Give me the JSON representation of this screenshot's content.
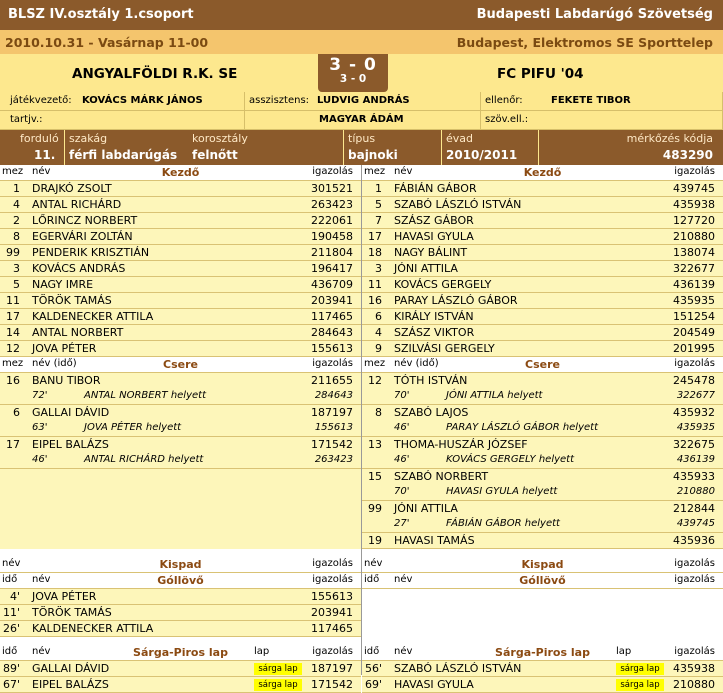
{
  "header": {
    "league": "BLSZ IV.osztály 1.csoport",
    "federation": "Budapesti Labdarúgó Szövetség",
    "date": "2010.10.31 - Vasárnap 11-00",
    "venue": "Budapest, Elektromos SE Sporttelep"
  },
  "match": {
    "home": "ANGYALFÖLDI R.K. SE",
    "away": "FC PIFU '04",
    "score": "3 - 0",
    "halftime": "3 - 0"
  },
  "officials": {
    "ref_label": "játékvezető:",
    "ref": "KOVÁCS MÁRK JÁNOS",
    "assist_label": "asszisztens:",
    "assist1": "LUDVIG ANDRÁS",
    "assist2": "MAGYAR ÁDÁM",
    "inspector_label": "ellenőr:",
    "inspector": "FEKETE TIBOR",
    "reserve_label": "tartjv.:",
    "reserve": "",
    "szov_label": "szöv.ell.:",
    "szov": ""
  },
  "info": {
    "round_label": "forduló",
    "round": "11.",
    "branch_label": "szakág",
    "branch": "férfi labdarúgás",
    "age_label": "korosztály",
    "age": "felnőtt",
    "type_label": "típus",
    "type": "bajnoki",
    "season_label": "évad",
    "season": "2010/2011",
    "code_label": "mérkőzés kódja",
    "code": "483290"
  },
  "labels": {
    "mez": "mez",
    "nev": "név",
    "igazolas": "igazolás",
    "ido": "idő",
    "nev_ido": "név (idő)",
    "lap": "lap",
    "kezdo": "Kezdő",
    "csere": "Csere",
    "kispad": "Kispad",
    "gollovo": "Góllövő",
    "sarga": "Sárga-Piros lap"
  },
  "home_start": [
    {
      "n": "1",
      "name": "DRAJKÓ ZSOLT",
      "id": "301521"
    },
    {
      "n": "4",
      "name": "ANTAL RICHÁRD",
      "id": "263423"
    },
    {
      "n": "2",
      "name": "LŐRINCZ NORBERT",
      "id": "222061"
    },
    {
      "n": "8",
      "name": "EGERVÁRI ZOLTÁN",
      "id": "190458"
    },
    {
      "n": "99",
      "name": "PENDERIK KRISZTIÁN",
      "id": "211804"
    },
    {
      "n": "3",
      "name": "KOVÁCS ANDRÁS",
      "id": "196417"
    },
    {
      "n": "5",
      "name": "NAGY IMRE",
      "id": "436709"
    },
    {
      "n": "11",
      "name": "TÖRÖK TAMÁS",
      "id": "203941"
    },
    {
      "n": "17",
      "name": "KALDENECKER ATTILA",
      "id": "117465"
    },
    {
      "n": "14",
      "name": "ANTAL NORBERT",
      "id": "284643"
    },
    {
      "n": "12",
      "name": "JOVA PÉTER",
      "id": "155613"
    }
  ],
  "away_start": [
    {
      "n": "1",
      "name": "FÁBIÁN GÁBOR",
      "id": "439745"
    },
    {
      "n": "5",
      "name": "SZABÓ LÁSZLÓ ISTVÁN",
      "id": "435938"
    },
    {
      "n": "7",
      "name": "SZÁSZ GÁBOR",
      "id": "127720"
    },
    {
      "n": "17",
      "name": "HAVASI GYULA",
      "id": "210880"
    },
    {
      "n": "18",
      "name": "NAGY BÁLINT",
      "id": "138074"
    },
    {
      "n": "3",
      "name": "JÓNI ATTILA",
      "id": "322677"
    },
    {
      "n": "11",
      "name": "KOVÁCS GERGELY",
      "id": "436139"
    },
    {
      "n": "16",
      "name": "PARAY LÁSZLÓ GÁBOR",
      "id": "435935"
    },
    {
      "n": "6",
      "name": "KIRÁLY ISTVÁN",
      "id": "151254"
    },
    {
      "n": "4",
      "name": "SZÁSZ VIKTOR",
      "id": "204549"
    },
    {
      "n": "9",
      "name": "SZILVÁSI GERGELY",
      "id": "201995"
    }
  ],
  "home_subs": [
    {
      "n": "16",
      "name": "BANU TIBOR",
      "id": "211655",
      "min": "72'",
      "for": "ANTAL NORBERT helyett",
      "for_id": "284643"
    },
    {
      "n": "6",
      "name": "GALLAI DÁVID",
      "id": "187197",
      "min": "63'",
      "for": "JOVA PÉTER helyett",
      "for_id": "155613"
    },
    {
      "n": "17",
      "name": "EIPEL BALÁZS",
      "id": "171542",
      "min": "46'",
      "for": "ANTAL RICHÁRD helyett",
      "for_id": "263423"
    }
  ],
  "away_subs": [
    {
      "n": "12",
      "name": "TÓTH ISTVÁN",
      "id": "245478",
      "min": "70'",
      "for": "JÓNI ATTILA helyett",
      "for_id": "322677"
    },
    {
      "n": "8",
      "name": "SZABÓ LAJOS",
      "id": "435932",
      "min": "46'",
      "for": "PARAY LÁSZLÓ GÁBOR helyett",
      "for_id": "435935"
    },
    {
      "n": "13",
      "name": "THOMA-HUSZÁR JÓZSEF",
      "id": "322675",
      "min": "46'",
      "for": "KOVÁCS GERGELY helyett",
      "for_id": "436139"
    },
    {
      "n": "15",
      "name": "SZABÓ NORBERT",
      "id": "435933",
      "min": "70'",
      "for": "HAVASI GYULA helyett",
      "for_id": "210880"
    },
    {
      "n": "99",
      "name": "JÓNI ATTILA",
      "id": "212844",
      "min": "27'",
      "for": "FÁBIÁN GÁBOR helyett",
      "for_id": "439745"
    },
    {
      "n": "19",
      "name": "HAVASI TAMÁS",
      "id": "435936",
      "min": "",
      "for": "",
      "for_id": ""
    }
  ],
  "home_goals": [
    {
      "min": "4'",
      "name": "JOVA PÉTER",
      "id": "155613"
    },
    {
      "min": "11'",
      "name": "TÖRÖK TAMÁS",
      "id": "203941"
    },
    {
      "min": "26'",
      "name": "KALDENECKER ATTILA",
      "id": "117465"
    }
  ],
  "home_cards": [
    {
      "min": "89'",
      "name": "GALLAI DÁVID",
      "card": "sárga lap",
      "id": "187197"
    },
    {
      "min": "67'",
      "name": "EIPEL BALÁZS",
      "card": "sárga lap",
      "id": "171542"
    }
  ],
  "away_cards": [
    {
      "min": "56'",
      "name": "SZABÓ LÁSZLÓ ISTVÁN",
      "card": "sárga lap",
      "id": "435938"
    },
    {
      "min": "69'",
      "name": "HAVASI GYULA",
      "card": "sárga lap",
      "id": "210880"
    }
  ]
}
